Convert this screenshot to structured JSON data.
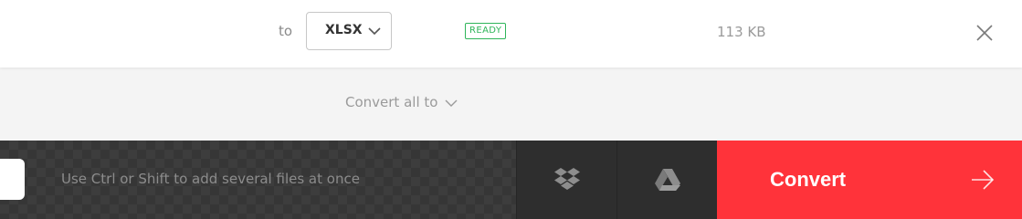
{
  "file_row": {
    "to_label": "to",
    "format_value": "XLSX",
    "status": "READY",
    "size": "113 KB",
    "remove_icon": "close-icon"
  },
  "convert_all": {
    "label": "Convert all to",
    "icon": "chevron-down-icon"
  },
  "bottom_bar": {
    "hint": "Use Ctrl or Shift to add several files at once",
    "dropbox_icon": "dropbox-icon",
    "gdrive_icon": "google-drive-icon",
    "convert_label": "Convert",
    "convert_icon": "arrow-right-icon"
  },
  "colors": {
    "accent": "#ff333a",
    "ready": "#2fb55a",
    "bar_bg": "#363636"
  }
}
